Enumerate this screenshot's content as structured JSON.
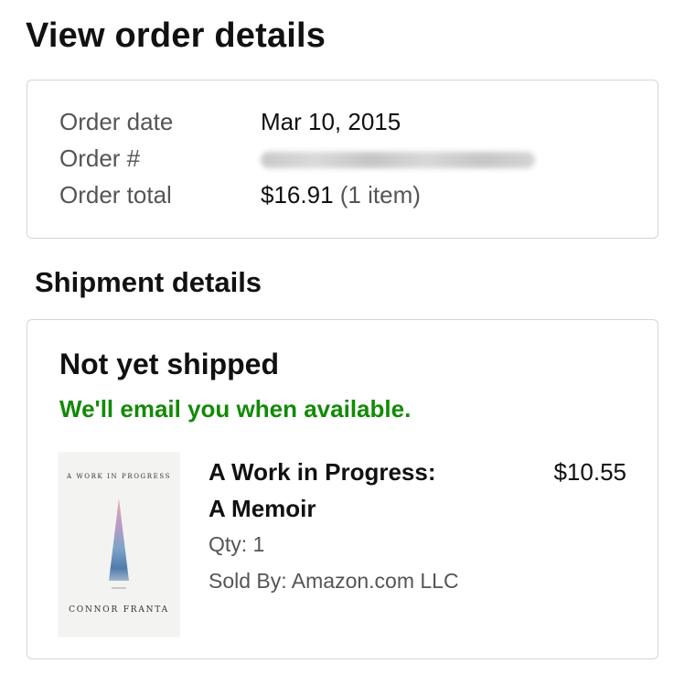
{
  "page": {
    "title": "View order details"
  },
  "order_summary": {
    "date_label": "Order date",
    "date_value": "Mar 10, 2015",
    "number_label": "Order #",
    "number_value_redacted": true,
    "total_label": "Order total",
    "total_value": "$16.91",
    "total_items": "(1 item)"
  },
  "shipment": {
    "section_title": "Shipment details",
    "status": "Not yet shipped",
    "status_note": "We'll email you when available.",
    "status_note_color": "#138a07",
    "item": {
      "title_line1": "A Work in Progress:",
      "title_line2": "A Memoir",
      "price": "$10.55",
      "qty": "Qty: 1",
      "sold_by": "Sold By: Amazon.com LLC",
      "cover": {
        "title": "A WORK IN PROGRESS",
        "author": "CONNOR FRANTA"
      }
    }
  }
}
